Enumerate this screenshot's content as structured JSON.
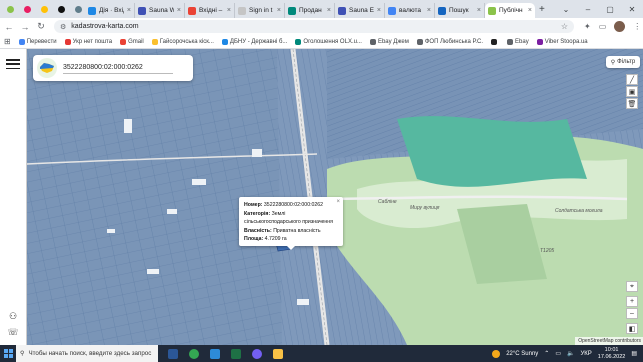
{
  "browser": {
    "tabs": [
      {
        "label": "",
        "color": "#8bc34a"
      },
      {
        "label": "",
        "color": "#e91e63"
      },
      {
        "label": "",
        "color": "#ffc107"
      },
      {
        "label": "",
        "color": "#111111"
      },
      {
        "label": "",
        "color": "#607d8b"
      },
      {
        "label": "Дія · Вхід",
        "color": "#1e88e5"
      },
      {
        "label": "Sauna W",
        "color": "#3f51b5"
      },
      {
        "label": "Вхідні –",
        "color": "#ea4335"
      },
      {
        "label": "Sign in t",
        "color": "#c5c5c5"
      },
      {
        "label": "Продан",
        "color": "#00897b"
      },
      {
        "label": "Sauna Er",
        "color": "#3f51b5"
      },
      {
        "label": "валюта",
        "color": "#4285f4"
      },
      {
        "label": "Пошук",
        "color": "#1565c0"
      },
      {
        "label": "Публічн",
        "color": "#8bc34a",
        "active": true
      }
    ],
    "new_tab": "+",
    "window_controls": [
      "⌄",
      "–",
      "▢",
      "✕"
    ],
    "url": "kadastrova-karta.com",
    "bookmarks": [
      {
        "label": "Перевести",
        "color": "#4285f4"
      },
      {
        "label": "Укр нет пошта",
        "color": "#e53935"
      },
      {
        "label": "Gmail",
        "color": "#ea4335"
      },
      {
        "label": "Гайсорочська кіск...",
        "color": "#fbc02d"
      },
      {
        "label": "ДБНУ - Державні б...",
        "color": "#1e88e5"
      },
      {
        "label": "Оголошення OLX.u...",
        "color": "#00897b"
      },
      {
        "label": "Ebay Джем",
        "color": "#5f6368"
      },
      {
        "label": "ФОП Любинська Р.С.",
        "color": "#5f6368"
      },
      {
        "label": "",
        "color": "#222222"
      },
      {
        "label": "Ebay",
        "color": "#5f6368"
      },
      {
        "label": "Viber Stoopa.ua",
        "color": "#7b1fa2"
      }
    ]
  },
  "app": {
    "search_value": "3522280800:02:000:0262",
    "filter_label": "Фільтр",
    "popup": {
      "number_label": "Номер:",
      "number_value": "3522280800:02:000:0262",
      "category_label": "Категорія:",
      "category_value": "Землі сільськогосподарського призначення",
      "ownership_label": "Власність:",
      "ownership_value": "Приватна власність",
      "area_label": "Площа:",
      "area_value": "4.7209 га",
      "close": "×"
    },
    "map_labels": {
      "village": "Сабліне",
      "street": "Миру вулиця",
      "road": "Т1205",
      "landmark": "Солдатська могила"
    },
    "attribution": "OpenStreetMap contributors"
  },
  "taskbar": {
    "search_placeholder": "Чтобы начать поиск, введите здесь запрос",
    "weather": "22°C  Sunny",
    "lang": "УКР",
    "time": "10:01",
    "date": "17.06.2022"
  }
}
